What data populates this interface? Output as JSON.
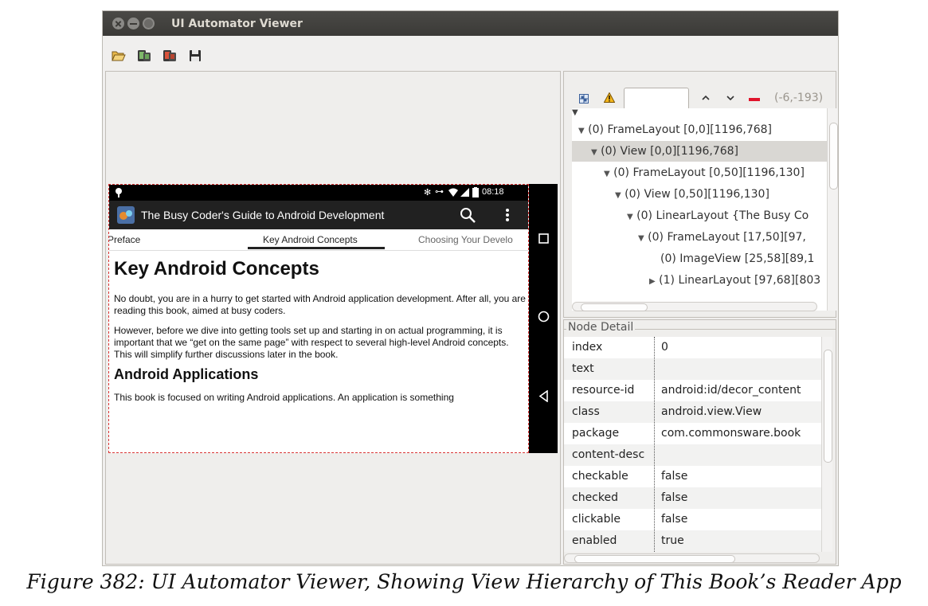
{
  "window": {
    "title": "UI Automator Viewer"
  },
  "toolbar": {
    "icons": [
      "open-folder-icon",
      "device-screenshot-icon",
      "device-screenshot-compressed-icon",
      "save-icon"
    ]
  },
  "device": {
    "status_time": "08:18",
    "app_title": "The Busy Coder's Guide to Android Development",
    "tabs": [
      "Preface",
      "Key Android Concepts",
      "Choosing Your Develo"
    ],
    "heading": "Key Android Concepts",
    "paragraphs": [
      "No doubt, you are in a hurry to get started with Android application development. After all, you are reading this book, aimed at busy coders.",
      "However, before we dive into getting tools set up and starting in on actual programming, it is important that we “get on the same page” with respect to several high-level Android concepts. This will simplify further discussions later in the book."
    ],
    "subheading": "Android Applications",
    "last_paragraph": "This book is focused on writing Android applications. An application is something"
  },
  "hierarchy": {
    "coords": "(-6,-193)",
    "nodes": [
      {
        "text": "(0) FrameLayout [0,0][1196,768]",
        "arrow": "▼",
        "selected": false
      },
      {
        "text": "(0) View [0,0][1196,768]",
        "arrow": "▼",
        "selected": true
      },
      {
        "text": "(0) FrameLayout [0,50][1196,130]",
        "arrow": "▼",
        "selected": false
      },
      {
        "text": "(0) View [0,50][1196,130]",
        "arrow": "▼",
        "selected": false
      },
      {
        "text": "(0) LinearLayout {The Busy Co",
        "arrow": "▼",
        "selected": false
      },
      {
        "text": "(0) FrameLayout [17,50][97,",
        "arrow": "▼",
        "selected": false
      },
      {
        "text": "(0) ImageView [25,58][89,1",
        "arrow": "",
        "selected": false
      },
      {
        "text": "(1) LinearLayout [97,68][803",
        "arrow": "▶",
        "selected": false
      }
    ]
  },
  "node_detail": {
    "label": "Node Detail",
    "rows": [
      {
        "key": "index",
        "value": "0"
      },
      {
        "key": "text",
        "value": ""
      },
      {
        "key": "resource-id",
        "value": "android:id/decor_content"
      },
      {
        "key": "class",
        "value": "android.view.View"
      },
      {
        "key": "package",
        "value": "com.commonsware.book"
      },
      {
        "key": "content-desc",
        "value": ""
      },
      {
        "key": "checkable",
        "value": "false"
      },
      {
        "key": "checked",
        "value": "false"
      },
      {
        "key": "clickable",
        "value": "false"
      },
      {
        "key": "enabled",
        "value": "true"
      }
    ]
  },
  "caption": "Figure 382: UI Automator Viewer, Showing View Hierarchy of This Book’s Reader App"
}
